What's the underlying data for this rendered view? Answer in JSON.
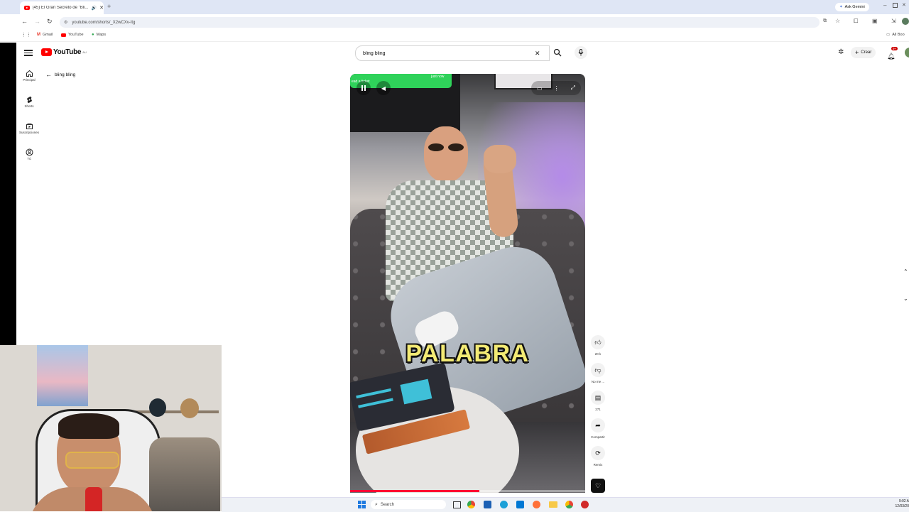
{
  "browser": {
    "tab_title": "(45) El Gran Secreto de \"Bli...",
    "url": "youtube.com/shorts/_X2wCXv-Itg",
    "ask_gemini": "Ask Gemini",
    "bookmarks": [
      {
        "label": "Gmail",
        "icon": "gmail-icon",
        "color": "#ea4335"
      },
      {
        "label": "YouTube",
        "icon": "youtube-icon",
        "color": "#ff0000"
      },
      {
        "label": "Maps",
        "icon": "maps-pin-icon",
        "color": "#34a853"
      }
    ],
    "all_bookmarks": "All Boo"
  },
  "youtube": {
    "logo_text": "YouTube",
    "country_code": "AU",
    "search_value": "bling bling",
    "create_label": "Crear",
    "notification_count": "9+",
    "back_label": "bling bling",
    "sidebar": [
      {
        "label": "Principal",
        "icon": "home-icon"
      },
      {
        "label": "Shorts",
        "icon": "shorts-icon"
      },
      {
        "label": "Suscripciones",
        "icon": "subscriptions-icon"
      },
      {
        "label": "Tú",
        "icon": "account-icon"
      }
    ]
  },
  "video": {
    "caption": "PALABRA",
    "banner_text": "just now",
    "banner_subtext": "ead a ticket",
    "progress": 0.55
  },
  "actions": [
    {
      "label": "20 k",
      "icon": "like-icon"
    },
    {
      "label": "No me ...",
      "icon": "dislike-icon"
    },
    {
      "label": "271",
      "icon": "comment-icon"
    },
    {
      "label": "Compartir",
      "icon": "share-icon"
    },
    {
      "label": "Remix",
      "icon": "remix-icon"
    }
  ],
  "taskbar": {
    "search_label": "Search",
    "time": "9:02 A",
    "date": "12/03/20"
  },
  "colors": {
    "youtube_red": "#ff0000",
    "caption_yellow": "#f3ea74",
    "banner_green": "#2fd25a"
  }
}
